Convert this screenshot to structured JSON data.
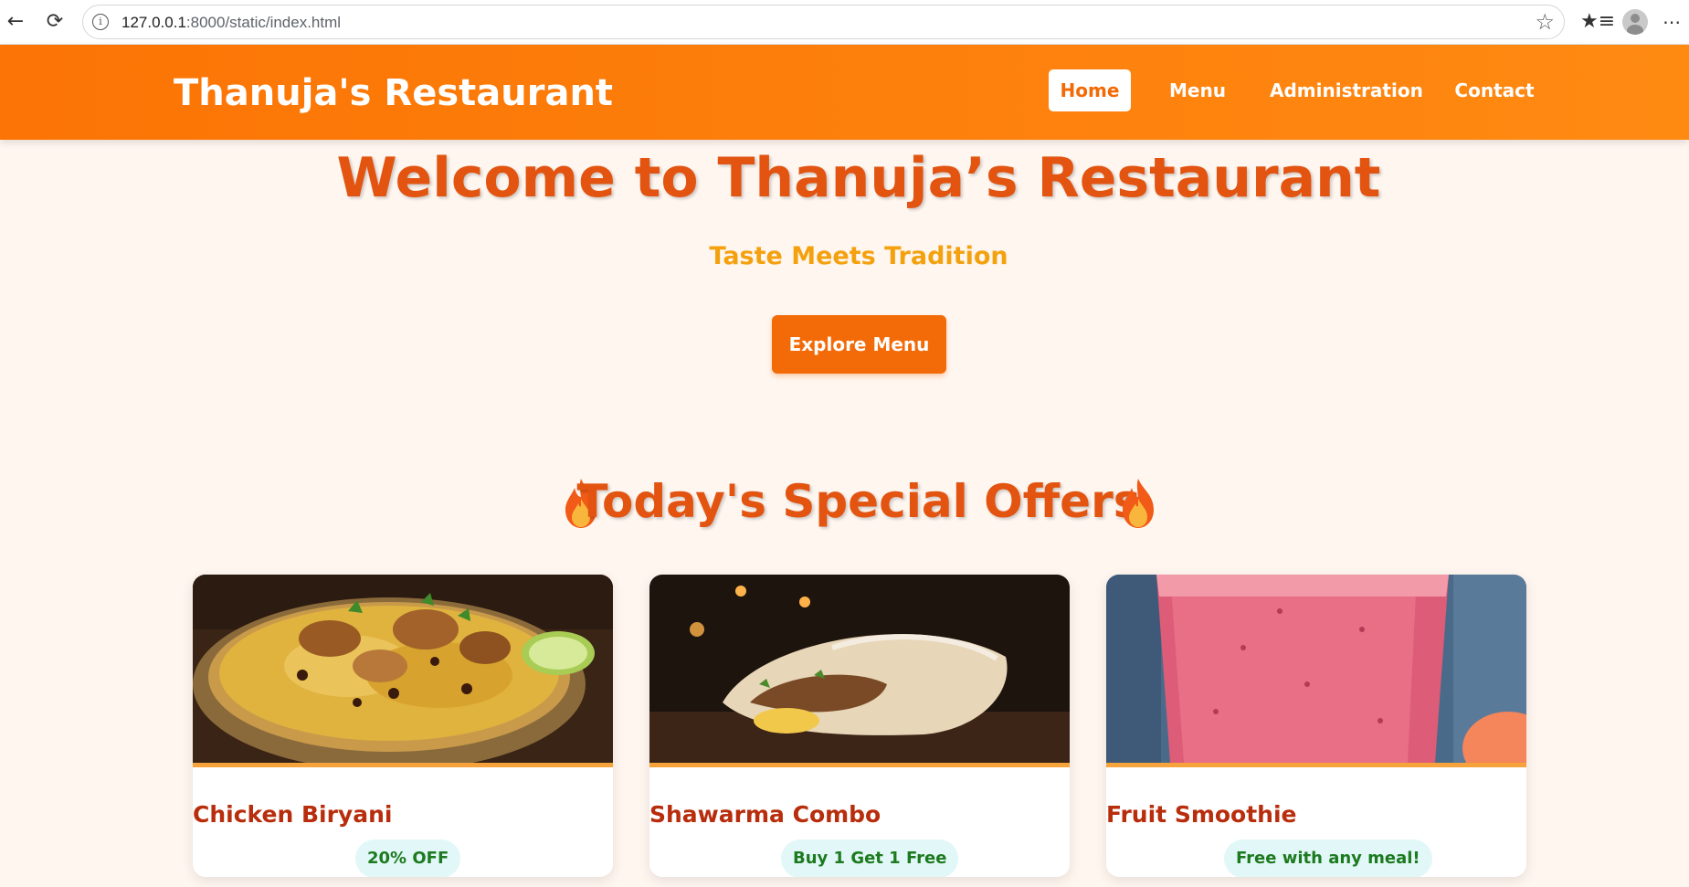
{
  "browser": {
    "url_host": "127.0.0.1",
    "url_rest": ":8000/static/index.html",
    "icons": [
      "back-icon",
      "reload-icon",
      "info-icon",
      "star-icon",
      "favorites-icon",
      "profile-icon",
      "more-icon"
    ]
  },
  "header": {
    "brand": "Thanuja's Restaurant",
    "nav": {
      "home": "Home",
      "menu": "Menu",
      "administration": "Administration",
      "contact": "Contact"
    }
  },
  "hero": {
    "title": "Welcome to Thanuja’s Restaurant",
    "subtitle": "Taste Meets Tradition",
    "cta": "Explore Menu"
  },
  "offers": {
    "title": "Today's Special Offers",
    "items": [
      {
        "name": "Chicken Biryani",
        "badge": "20% OFF",
        "image": "chicken-biryani-photo"
      },
      {
        "name": "Shawarma Combo",
        "badge": "Buy 1 Get 1 Free",
        "image": "shawarma-photo"
      },
      {
        "name": "Fruit Smoothie",
        "badge": "Free with any meal!",
        "image": "smoothie-photo"
      }
    ]
  },
  "colors": {
    "header": "#fb7405",
    "title": "#e25410",
    "subtitle": "#f4a10f",
    "button": "#f36b08",
    "card_name": "#b82d0c",
    "badge_bg": "#e2f7f7",
    "badge_text": "#1c7a1f",
    "page_bg": "#fff6f0"
  }
}
